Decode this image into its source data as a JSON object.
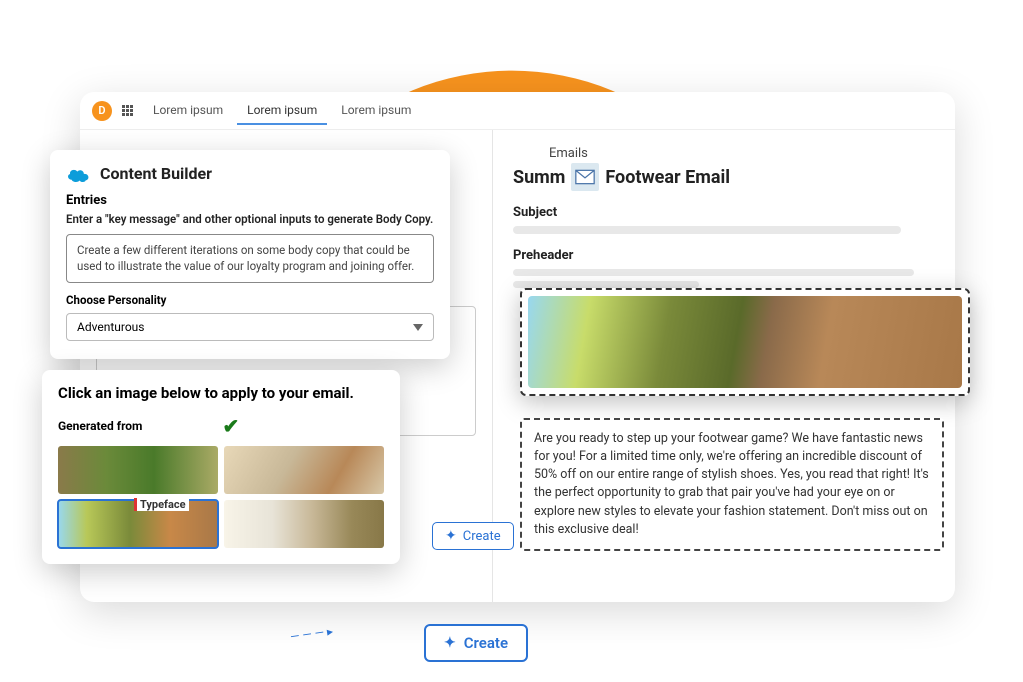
{
  "topbar": {
    "avatar_letter": "D",
    "tabs": [
      "Lorem ipsum",
      "Lorem ipsum",
      "Lorem ipsum"
    ],
    "active_tab_index": 1
  },
  "builder": {
    "title": "Content Builder",
    "entries_label": "Entries",
    "entries_sub": "Enter a \"key message\" and other optional inputs to generate Body Copy.",
    "prompt": "Create a few different iterations on some body copy that could be used to illustrate the value of our loyalty program and joining offer.",
    "personality_label": "Choose Personality",
    "personality_value": "Adventurous"
  },
  "picker": {
    "title": "Click an image below to apply to your email.",
    "generated_label": "Generated from",
    "typeface_label": "Typeface",
    "selected_index": 2
  },
  "email": {
    "section_label": "Emails",
    "title_left": "Summ",
    "title_right": "Footwear Email",
    "subject_label": "Subject",
    "preheader_label": "Preheader",
    "body": "Are you ready to step up your footwear game? We have fantastic news for you! For a limited time only, we're offering an incredible discount of 50% off on our entire range of stylish shoes. Yes, you read that right! It's the perfect opportunity to grab that pair you've had your eye on or explore new styles to elevate your fashion statement. Don't miss out on this exclusive deal!"
  },
  "buttons": {
    "create": "Create"
  }
}
